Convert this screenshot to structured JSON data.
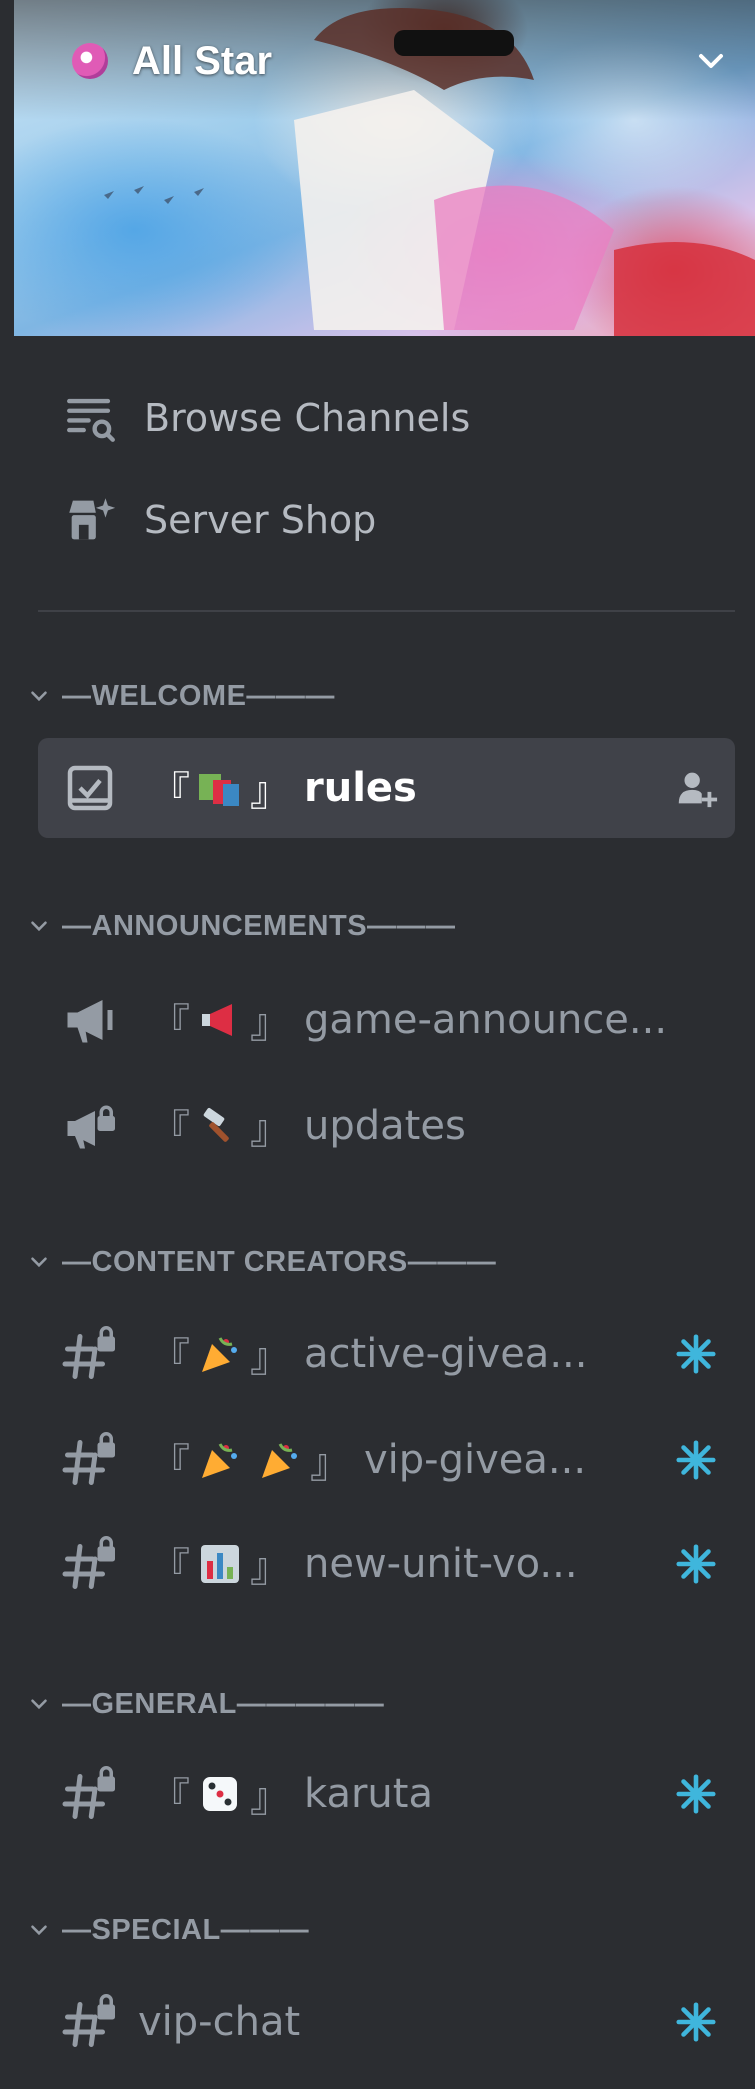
{
  "server": {
    "name": "All Star"
  },
  "nav": [
    {
      "label": "Browse Channels",
      "icon": "browse-channels-icon"
    },
    {
      "label": "Server Shop",
      "icon": "server-shop-icon"
    }
  ],
  "categories": [
    {
      "label": "—WELCOME———"
    },
    {
      "label": "—ANNOUNCEMENTS———"
    },
    {
      "label": "—CONTENT CREATORS———"
    },
    {
      "label": "—GENERAL—————"
    },
    {
      "label": "—SPECIAL———"
    }
  ],
  "channels": [
    {
      "open": "『",
      "close": "』",
      "name": "rules",
      "icon": "rules-icon",
      "emoji": "books-emoji",
      "trailing": "add-member-icon",
      "selected": true
    },
    {
      "open": "『",
      "close": "』",
      "name": "game-announce...",
      "icon": "announcement-icon",
      "emoji": "megaphone-emoji"
    },
    {
      "open": "『",
      "close": "』",
      "name": "updates",
      "icon": "announcement-locked-icon",
      "emoji": "hammer-emoji"
    },
    {
      "open": "『",
      "close": "』",
      "name": "active-givea...",
      "icon": "locked-text-channel-icon",
      "emoji": "party-popper-emoji",
      "trailing": "new-activity-icon"
    },
    {
      "open": "『",
      "close": "』",
      "name": "vip-givea...",
      "icon": "locked-text-channel-icon",
      "emoji": "party-popper-emoji",
      "trailing": "new-activity-icon"
    },
    {
      "open": "『",
      "close": "』",
      "name": "new-unit-vo...",
      "icon": "locked-text-channel-icon",
      "emoji": "bar-chart-emoji",
      "trailing": "new-activity-icon"
    },
    {
      "open": "『",
      "close": "』",
      "name": "karuta",
      "icon": "locked-text-channel-icon",
      "emoji": "dice-emoji",
      "trailing": "new-activity-icon"
    },
    {
      "name": "vip-chat",
      "icon": "locked-text-channel-icon",
      "trailing": "new-activity-icon"
    }
  ],
  "colors": {
    "background": "#2b2d31",
    "selected": "#404249",
    "accent": "#3fb6dc",
    "text_muted": "#949ba4"
  }
}
